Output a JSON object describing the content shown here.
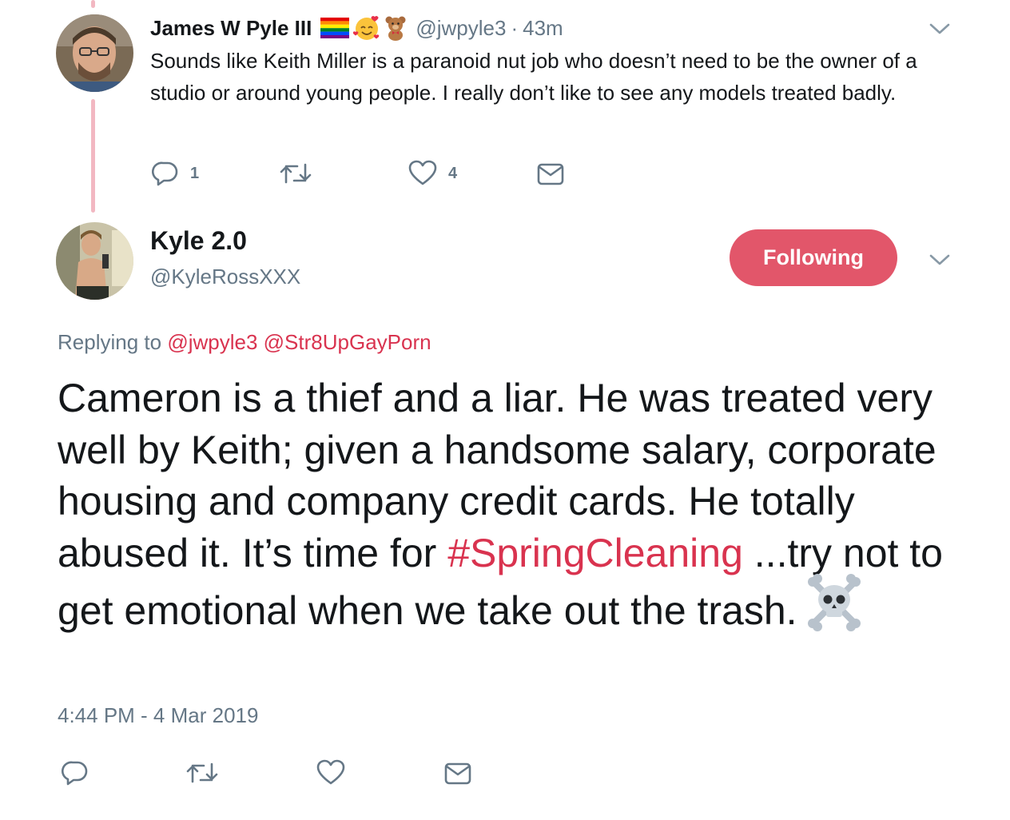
{
  "reply_tweet": {
    "name": "James W Pyle III",
    "emojis": [
      "rainbow-flag",
      "smiling-face-with-hearts",
      "teddy-bear"
    ],
    "handle": "@jwpyle3",
    "separator": "·",
    "time": "43m",
    "text": "Sounds like Keith Miller is a paranoid nut job who doesn’t need to be the owner of a studio or around young people.  I really don’t like to see any models treated badly.",
    "actions": {
      "reply_count": "1",
      "retweet_count": "",
      "like_count": "4"
    }
  },
  "main_tweet": {
    "name": "Kyle 2.0",
    "handle": "@KyleRossXXX",
    "follow_button": "Following",
    "replying_prefix": "Replying to",
    "replying_mentions": [
      "@jwpyle3",
      "@Str8UpGayPorn"
    ],
    "text_part1": "Cameron is a thief and a liar. He was treated very well by Keith; given a handsome salary, corporate housing and company credit cards. He totally abused it. It’s time for ",
    "hashtag": "#SpringCleaning",
    "text_part2": " ...try not to get emotional when we take out the trash.",
    "emoji_end": "skull-and-crossbones",
    "timestamp": "4:44 PM - 4 Mar 2019"
  },
  "colors": {
    "text": "#14171a",
    "secondary": "#657786",
    "accent": "#e2566a",
    "link": "#d9334f",
    "thread_line": "#f2b8c2"
  },
  "icons": [
    "reply-icon",
    "retweet-icon",
    "like-icon",
    "dm-icon",
    "chevron-down-icon"
  ]
}
